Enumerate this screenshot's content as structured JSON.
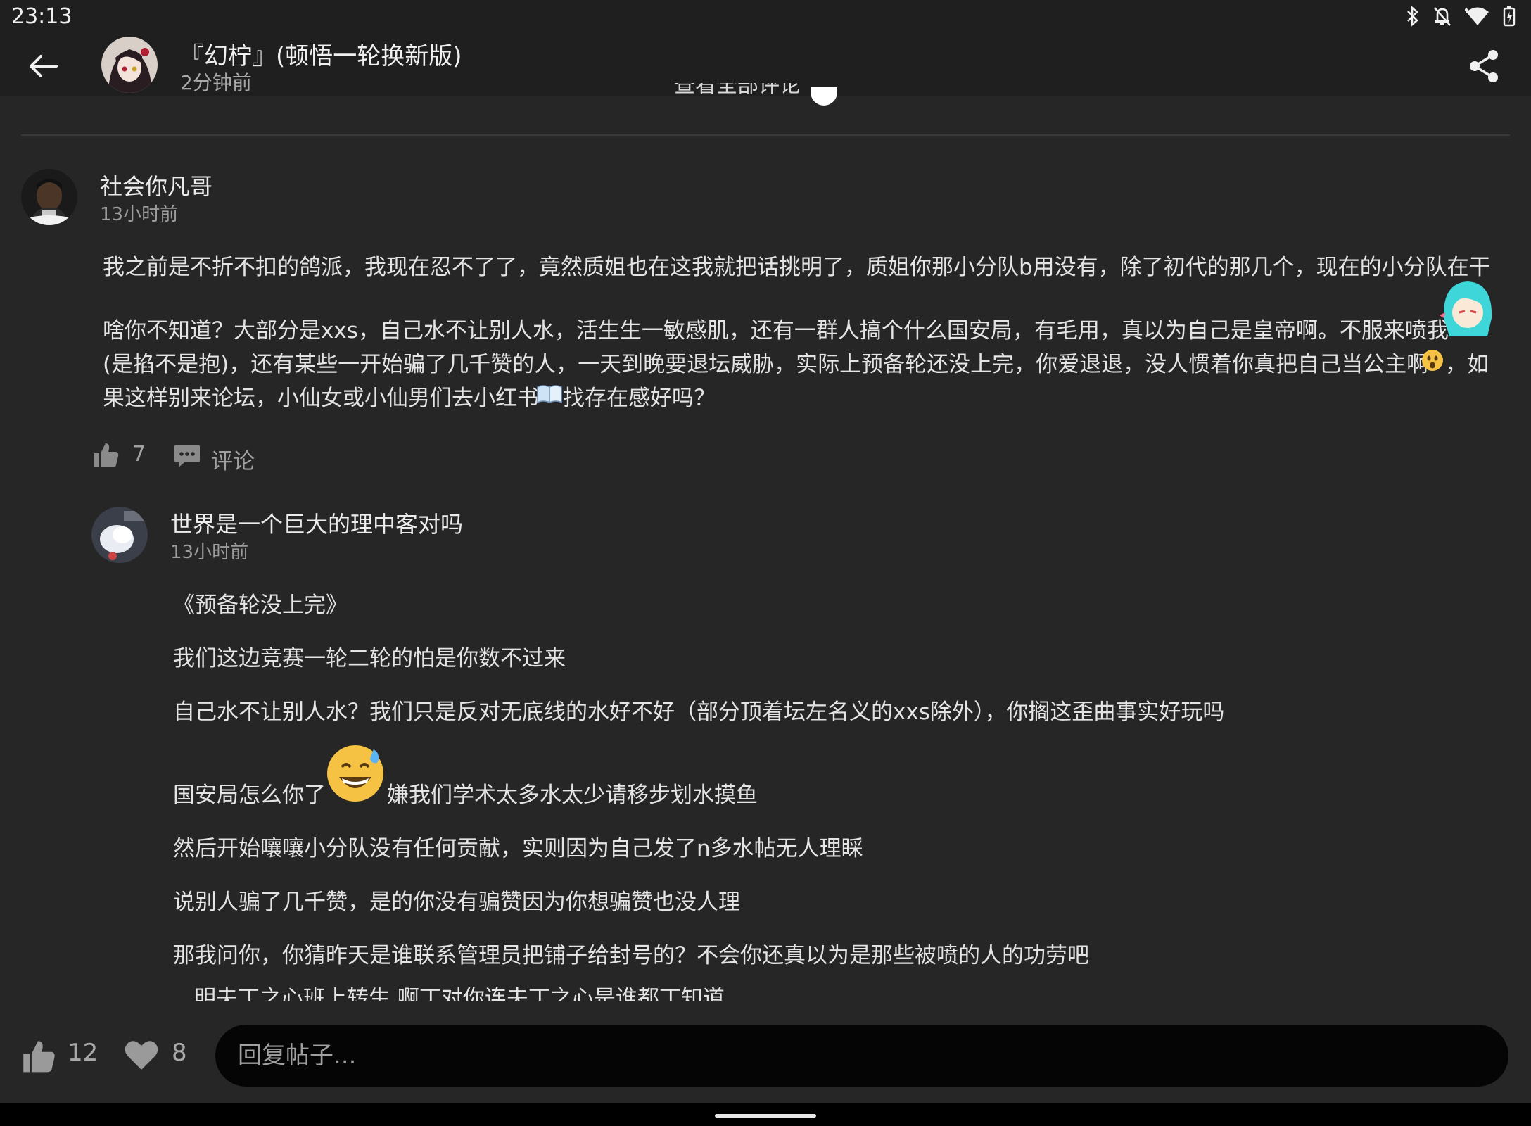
{
  "status_bar": {
    "time": "23:13",
    "icons": [
      "bluetooth-icon",
      "notifications-off-icon",
      "wifi-icon",
      "battery-charging-icon"
    ]
  },
  "header": {
    "title": "『幻柠』(顿悟一轮换新版)",
    "time_ago": "2分钟前",
    "hidden_label": "查看全部评论"
  },
  "comments": [
    {
      "author": "社会你凡哥",
      "time_ago": "13小时前",
      "lines": [
        "我之前是不折不扣的鸽派，我现在忍不了了，竟然质姐也在这我就把话挑明了，质姐你那小分队b用没有，除了初代的那几个，现在的小分队在干",
        "啥你不知道？大部分是xxs，自己水不让别人水，活生生一敏感肌，还有一群人搞个什么国安局，有毛用，真以为自己是皇帝啊。不服来喷我",
        "(是掐不是抱)，还有某些一开始骗了几千赞的人，一天到晚要退坛威胁，实际上预备轮还没上完，你爱退退，没人惯着你真把自己当公主啊",
        "，如",
        "果这样别来论坛，小仙女或小仙男们去小红书",
        "找存在感好吗？"
      ],
      "like_count": "7",
      "comment_label": "评论"
    },
    {
      "author": "世界是一个巨大的理中客对吗",
      "time_ago": "13小时前",
      "lines": [
        "《预备轮没上完》",
        "我们这边竞赛一轮二轮的怕是你数不过来",
        "自己水不让别人水？我们只是反对无底线的水好不好（部分顶着坛左名义的xxs除外），你搁这歪曲事实好玩吗",
        "国安局怎么你了",
        "嫌我们学术太多水太少请移步划水摸鱼",
        "然后开始嚷嚷小分队没有任何贡献，实则因为自己发了n多水帖无人理睬",
        "说别人骗了几千赞，是的你没有骗赞因为你想骗赞也没人理",
        "那我问你，你猜昨天是谁联系管理员把铺子给封号的？不会你还真以为是那些被喷的人的功劳吧",
        "明夫丁之心班上转生 啊丁对你连夫丁之心是谁都丁知道"
      ]
    }
  ],
  "bottom_bar": {
    "like_count": "12",
    "favorite_count": "8",
    "reply_placeholder": "回复帖子..."
  }
}
